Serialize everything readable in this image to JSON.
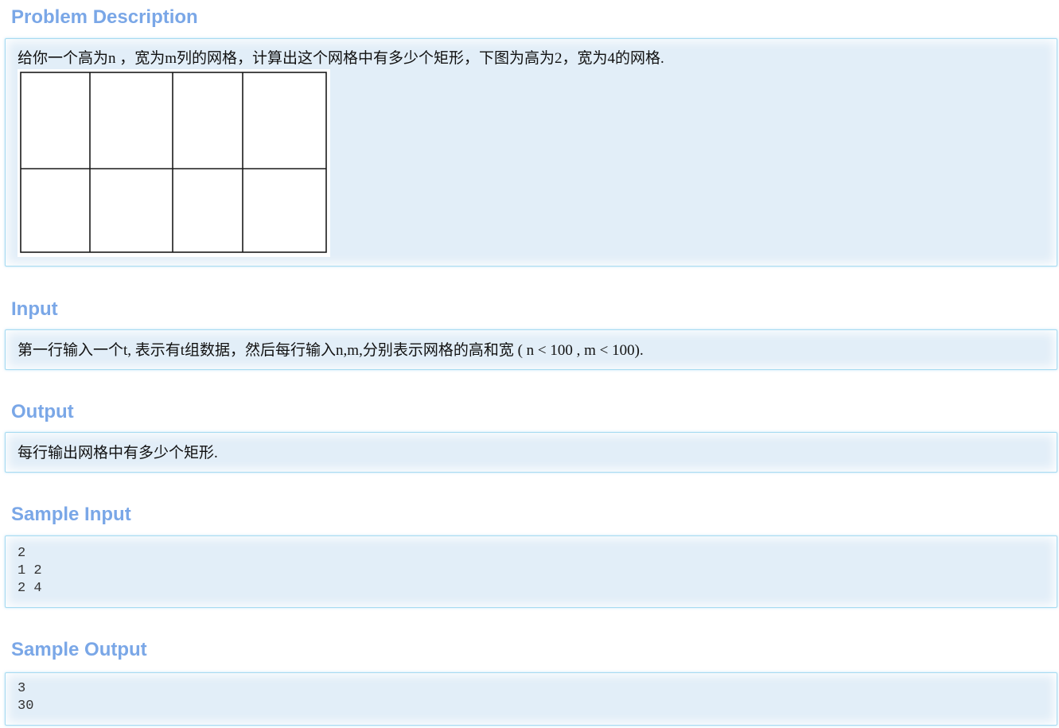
{
  "colors": {
    "heading": "#7aa7e7",
    "panel_bg": "#e2eef8",
    "panel_border": "#a7dbf1"
  },
  "sections": {
    "description": {
      "title": "Problem Description",
      "text": "给你一个高为n ，宽为m列的网格，计算出这个网格中有多少个矩形，下图为高为2，宽为4的网格.",
      "figure": {
        "rows": 2,
        "cols": 4
      }
    },
    "input": {
      "title": "Input",
      "text": "第一行输入一个t, 表示有t组数据，然后每行输入n,m,分别表示网格的高和宽 ( n < 100 , m < 100)."
    },
    "output": {
      "title": "Output",
      "text": "每行输出网格中有多少个矩形."
    },
    "sample_input": {
      "title": "Sample Input",
      "lines": [
        "2",
        "1 2",
        "2 4"
      ]
    },
    "sample_output": {
      "title": "Sample Output",
      "lines": [
        "3",
        "30"
      ]
    }
  }
}
